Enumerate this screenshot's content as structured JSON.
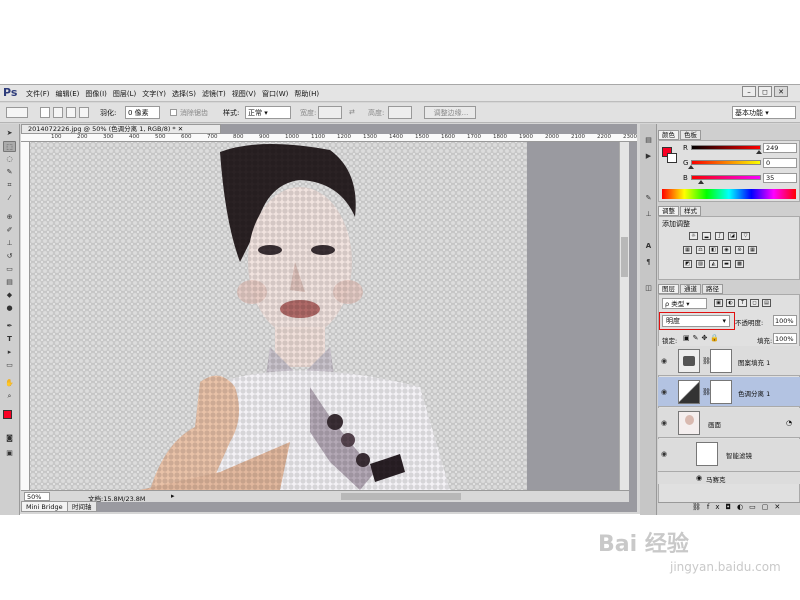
{
  "app": {
    "logo": "Ps"
  },
  "menu": [
    "文件(F)",
    "编辑(E)",
    "图像(I)",
    "图层(L)",
    "文字(Y)",
    "选择(S)",
    "滤镜(T)",
    "视图(V)",
    "窗口(W)",
    "帮助(H)"
  ],
  "options": {
    "feather_label": "羽化:",
    "feather_value": "0 像素",
    "antialias_label": "消除锯齿",
    "style_label": "样式:",
    "style_value": "正常",
    "width_label": "宽度:",
    "height_label": "高度:",
    "refine_button": "调整边缘...",
    "workspace": "基本功能"
  },
  "document": {
    "tab_title": "2014072226.jpg @ 50% (色调分离 1, RGB/8) *",
    "ruler_labels": [
      "100",
      "200",
      "300",
      "400",
      "500",
      "600",
      "700",
      "800",
      "900",
      "1000",
      "1100",
      "1200",
      "1300",
      "1400",
      "1500",
      "1600",
      "1700",
      "1800",
      "1900",
      "2000",
      "2100",
      "2200",
      "2300"
    ],
    "zoom": "50%",
    "doc_info": "文档:15.8M/23.8M"
  },
  "bottom_tabs": [
    "Mini Bridge",
    "时间轴"
  ],
  "color_panel": {
    "tabs": [
      "颜色",
      "色板"
    ],
    "r_label": "R",
    "g_label": "G",
    "b_label": "B",
    "r": "249",
    "g": "0",
    "b": "35",
    "r_fraction": 0.976,
    "g_fraction": 0.0,
    "b_fraction": 0.137,
    "foreground": "#f90023"
  },
  "adjust_panel": {
    "tabs": [
      "调整",
      "样式"
    ],
    "add_label": "添加调整"
  },
  "layers_panel": {
    "tabs": [
      "图层",
      "通道",
      "路径"
    ],
    "filter_label": "ρ 类型",
    "blend_mode": "明度",
    "opacity_label": "不透明度:",
    "opacity": "100%",
    "lock_label": "锁定:",
    "fill_label": "填充:",
    "fill": "100%",
    "layers": [
      {
        "name": "图案填充 1"
      },
      {
        "name": "色调分离 1"
      },
      {
        "name": "画面"
      },
      {
        "name": "智能滤镜"
      },
      {
        "name": "马赛克"
      }
    ]
  },
  "watermark": {
    "logo": "Bai 经验",
    "url": "jingyan.baidu.com"
  }
}
